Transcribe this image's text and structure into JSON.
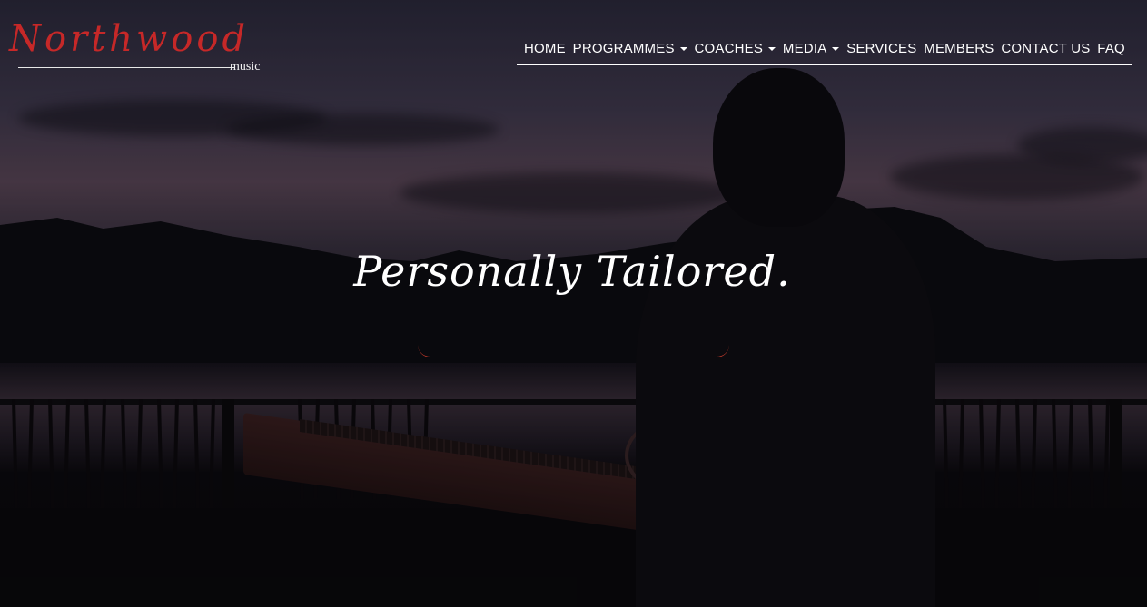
{
  "brand": {
    "logo_text": "Northwood",
    "logo_sub": "music",
    "logo_color": "#c62828"
  },
  "nav": {
    "items": [
      {
        "label": "HOME",
        "has_dropdown": false
      },
      {
        "label": "PROGRAMMES",
        "has_dropdown": true
      },
      {
        "label": "COACHES",
        "has_dropdown": true
      },
      {
        "label": "MEDIA",
        "has_dropdown": true
      },
      {
        "label": "SERVICES",
        "has_dropdown": false
      },
      {
        "label": "MEMBERS",
        "has_dropdown": false
      },
      {
        "label": "CONTACT US",
        "has_dropdown": false
      },
      {
        "label": "FAQ",
        "has_dropdown": false
      }
    ],
    "dropdown_icon": "chevron-down-icon"
  },
  "hero": {
    "tagline": "Personally Tailored.",
    "underline_color": "#c0392b"
  }
}
